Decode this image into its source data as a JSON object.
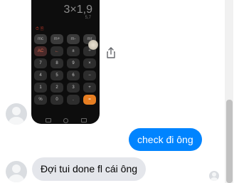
{
  "screenshot_image": {
    "expression": "3×1,9",
    "result": "5,7",
    "top_icons": "⏱ 🗎",
    "keys": [
      {
        "label": "mc",
        "kind": "mem"
      },
      {
        "label": "m+",
        "kind": "mem"
      },
      {
        "label": "m-",
        "kind": "mem"
      },
      {
        "label": "mr",
        "kind": "mem"
      },
      {
        "label": "AC",
        "kind": "clear"
      },
      {
        "label": "←",
        "kind": "back"
      },
      {
        "label": "±",
        "kind": "op"
      },
      {
        "label": "÷",
        "kind": "op"
      },
      {
        "label": "7",
        "kind": "num"
      },
      {
        "label": "8",
        "kind": "num"
      },
      {
        "label": "9",
        "kind": "num"
      },
      {
        "label": "×",
        "kind": "op"
      },
      {
        "label": "4",
        "kind": "num"
      },
      {
        "label": "5",
        "kind": "num"
      },
      {
        "label": "6",
        "kind": "num"
      },
      {
        "label": "−",
        "kind": "op"
      },
      {
        "label": "1",
        "kind": "num"
      },
      {
        "label": "2",
        "kind": "num"
      },
      {
        "label": "3",
        "kind": "num"
      },
      {
        "label": "+",
        "kind": "op"
      },
      {
        "label": "%",
        "kind": "op"
      },
      {
        "label": "0",
        "kind": "num"
      },
      {
        "label": ".",
        "kind": "num"
      },
      {
        "label": "=",
        "kind": "equals"
      }
    ]
  },
  "messages": {
    "sent_text": "check đi ông",
    "received_text": "Đợi tui done fl cái ông"
  },
  "colors": {
    "sent_bubble": "#0084ff",
    "received_bubble": "#e4e6eb",
    "calculator_accent": "#e67e22"
  },
  "icons": {
    "share": "share-icon",
    "avatar": "default-avatar-icon",
    "seen": "seen-avatar-icon"
  }
}
